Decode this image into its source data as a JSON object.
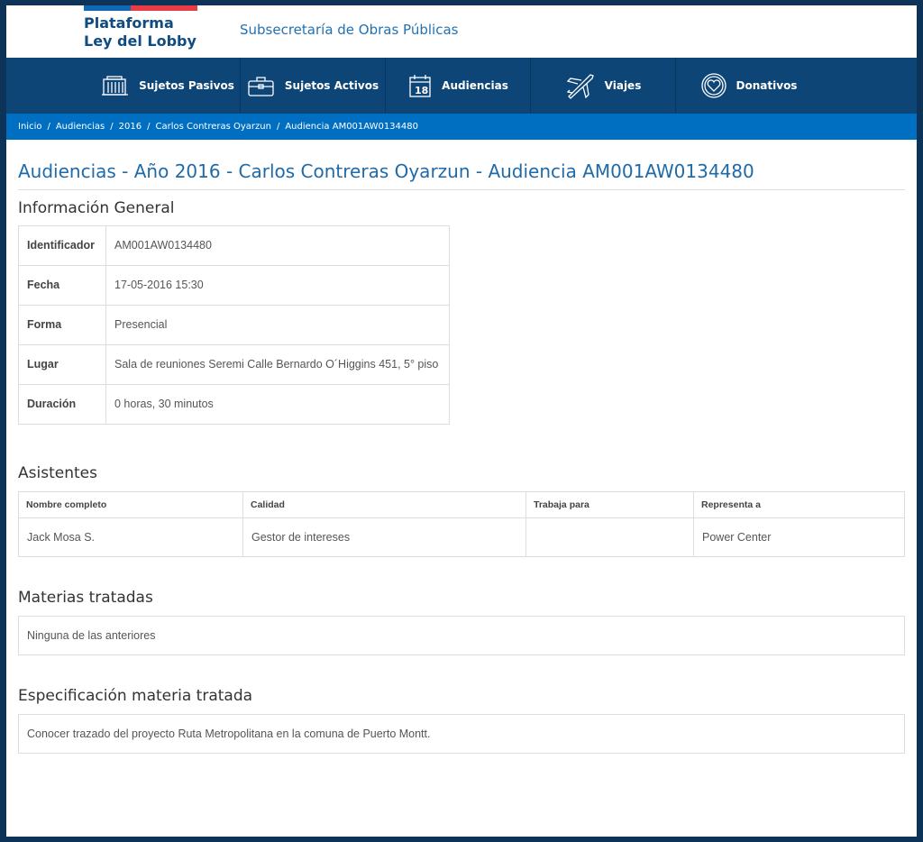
{
  "header": {
    "logo_line1": "Plataforma",
    "logo_line2": "Ley del Lobby",
    "subsecretaria": "Subsecretaría de Obras Públicas"
  },
  "nav": {
    "items": [
      {
        "label": "Sujetos Pasivos",
        "icon": "building-icon"
      },
      {
        "label": "Sujetos Activos",
        "icon": "briefcase-icon"
      },
      {
        "label": "Audiencias",
        "icon": "calendar-icon"
      },
      {
        "label": "Viajes",
        "icon": "airplane-icon"
      },
      {
        "label": "Donativos",
        "icon": "heart-icon"
      }
    ]
  },
  "breadcrumb": {
    "items": [
      "Inicio",
      "Audiencias",
      "2016",
      "Carlos Contreras Oyarzun",
      "Audiencia AM001AW0134480"
    ],
    "separator": "/"
  },
  "page_title": "Audiencias - Año 2016 - Carlos Contreras Oyarzun - Audiencia AM001AW0134480",
  "info_general": {
    "title": "Información General",
    "rows": [
      {
        "label": "Identificador",
        "value": "AM001AW0134480"
      },
      {
        "label": "Fecha",
        "value": "17-05-2016 15:30"
      },
      {
        "label": "Forma",
        "value": "Presencial"
      },
      {
        "label": "Lugar",
        "value": "Sala de reuniones Seremi Calle Bernardo O´Higgins 451, 5° piso"
      },
      {
        "label": "Duración",
        "value": "0 horas, 30 minutos"
      }
    ]
  },
  "asistentes": {
    "title": "Asistentes",
    "headers": [
      "Nombre completo",
      "Calidad",
      "Trabaja para",
      "Representa a"
    ],
    "rows": [
      [
        "Jack Mosa S.",
        "Gestor de intereses",
        "",
        "Power Center"
      ]
    ]
  },
  "materias": {
    "title": "Materias tratadas",
    "text": "Ninguna de las anteriores"
  },
  "especificacion": {
    "title": "Especificación materia tratada",
    "text": "Conocer trazado del proyecto Ruta Metropolitana en la comuna de Puerto Montt."
  },
  "colors": {
    "nav_bg": "#0e4577",
    "breadcrumb_bg": "#006fc2",
    "title_blue": "#1f6aa8",
    "flag_blue": "#0f69b4",
    "flag_red": "#eb3c46"
  }
}
